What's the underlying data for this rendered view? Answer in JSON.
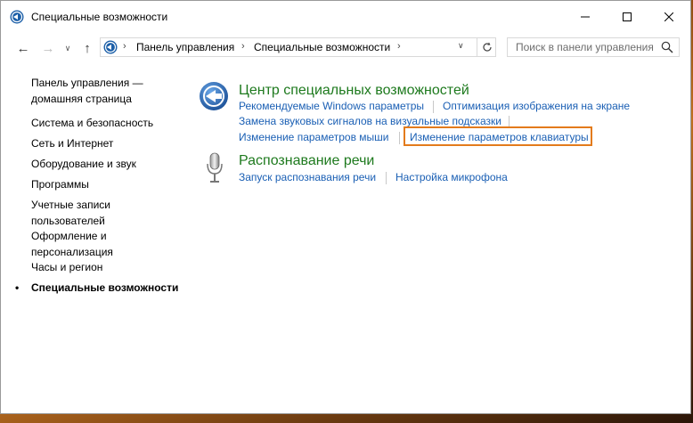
{
  "window": {
    "title": "Специальные возможности"
  },
  "titlebar": {
    "app_icon": "control-panel-icon",
    "minimize_icon": "minimize-icon",
    "maximize_icon": "maximize-icon",
    "close_icon": "close-icon"
  },
  "address": {
    "breadcrumbs": [
      "Панель управления",
      "Специальные возможности"
    ],
    "separator": "›",
    "search_placeholder": "Поиск в панели управления"
  },
  "sidebar": {
    "items": [
      {
        "label": "Панель управления — домашняя страница"
      },
      {
        "label": "Система и безопасность"
      },
      {
        "label": "Сеть и Интернет"
      },
      {
        "label": "Оборудование и звук"
      },
      {
        "label": "Программы"
      },
      {
        "label": "Учетные записи пользователей"
      },
      {
        "label": "Оформление и персонализация"
      },
      {
        "label": "Часы и регион"
      },
      {
        "label": "Специальные возможности",
        "current": true
      }
    ],
    "bullet": "•"
  },
  "sections": [
    {
      "title": "Центр специальных возможностей",
      "icon": "ease-of-access-icon",
      "links": [
        "Рекомендуемые Windows параметры",
        "Оптимизация изображения на экране",
        "Замена звуковых сигналов на визуальные подсказки",
        "Изменение параметров мыши",
        "Изменение параметров клавиатуры"
      ]
    },
    {
      "title": "Распознавание речи",
      "icon": "microphone-icon",
      "links": [
        "Запуск распознавания речи",
        "Настройка микрофона"
      ]
    }
  ],
  "colors": {
    "section_title": "#1e7a1e",
    "link": "#1a5fb4",
    "highlight": "#e37b1c"
  }
}
